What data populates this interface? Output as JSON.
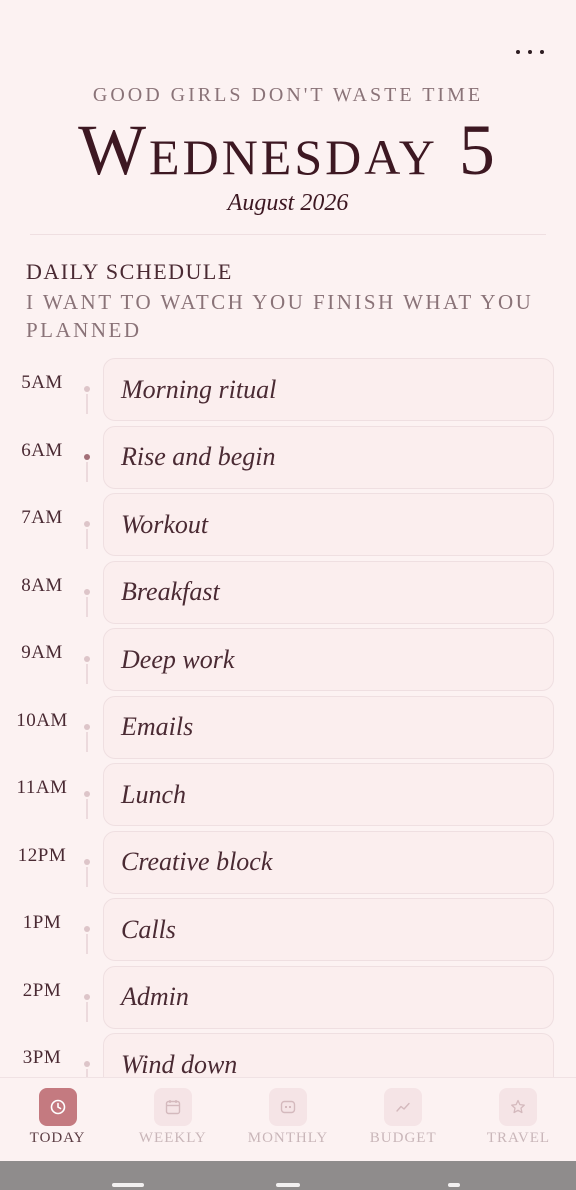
{
  "header": {
    "more_icon": "more-horizontal-icon",
    "tagline": "GOOD GIRLS DON'T WASTE TIME",
    "day_title": "Wednesday 5",
    "date": "August 2026"
  },
  "schedule": {
    "title": "DAILY SCHEDULE",
    "subtitle": "I WANT TO WATCH YOU FINISH WHAT YOU PLANNED",
    "slots": [
      {
        "time": "5AM",
        "task": "Morning ritual",
        "active": false
      },
      {
        "time": "6AM",
        "task": "Rise and begin",
        "active": true
      },
      {
        "time": "7AM",
        "task": "Workout",
        "active": false
      },
      {
        "time": "8AM",
        "task": "Breakfast",
        "active": false
      },
      {
        "time": "9AM",
        "task": "Deep work",
        "active": false
      },
      {
        "time": "10AM",
        "task": "Emails",
        "active": false
      },
      {
        "time": "11AM",
        "task": "Lunch",
        "active": false
      },
      {
        "time": "12PM",
        "task": "Creative block",
        "active": false
      },
      {
        "time": "1PM",
        "task": "Calls",
        "active": false
      },
      {
        "time": "2PM",
        "task": "Admin",
        "active": false
      },
      {
        "time": "3PM",
        "task": "Wind down",
        "active": false
      }
    ]
  },
  "nav": {
    "items": [
      {
        "label": "TODAY",
        "icon": "clock-icon",
        "active": true
      },
      {
        "label": "WEEKLY",
        "icon": "calendar-icon",
        "active": false
      },
      {
        "label": "MONTHLY",
        "icon": "monthly-grid-icon",
        "active": false
      },
      {
        "label": "BUDGET",
        "icon": "trend-chart-icon",
        "active": false
      },
      {
        "label": "TRAVEL",
        "icon": "star-icon",
        "active": false
      }
    ]
  },
  "colors": {
    "background": "#fcf2f2",
    "accent": "#c47a80",
    "title": "#3d1822",
    "muted": "#8a7378"
  }
}
